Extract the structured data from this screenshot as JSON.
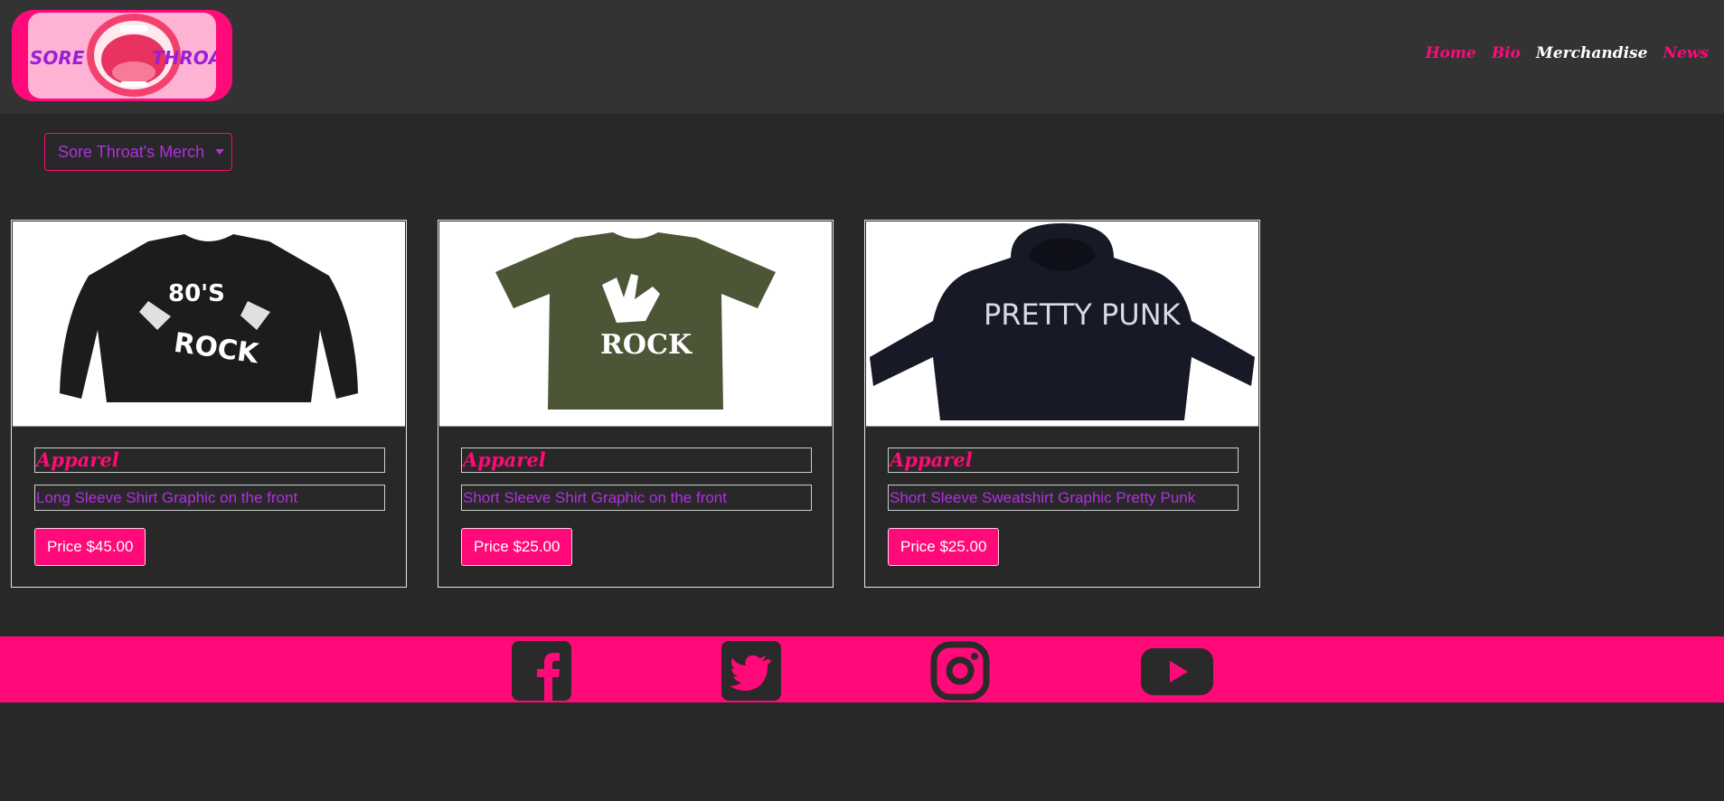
{
  "header": {
    "logo_left_word": "SORE",
    "logo_right_word": "THROAT",
    "nav": [
      {
        "label": "Home",
        "active": false
      },
      {
        "label": "Bio",
        "active": false
      },
      {
        "label": "Merchandise",
        "active": true
      },
      {
        "label": "News",
        "active": false
      }
    ]
  },
  "dropdown": {
    "label": "Sore Throat's Merch",
    "icon": "caret-down-icon"
  },
  "products": [
    {
      "category": "Apparel",
      "description": "Long Sleeve Shirt Graphic on the front",
      "price_label": "Price $45.00",
      "shirt_text_top": "80'S",
      "shirt_text_bottom": "ROCK",
      "shirt_color": "#1c1c1e"
    },
    {
      "category": "Apparel",
      "description": "Short Sleeve Shirt Graphic on the front",
      "price_label": "Price $25.00",
      "shirt_text_bottom": "ROCK",
      "shirt_color": "#4c5636"
    },
    {
      "category": "Apparel",
      "description": "Short Sleeve Sweatshirt Graphic Pretty Punk",
      "price_label": "Price $25.00",
      "shirt_text": "PRETTY PUNK",
      "shirt_color": "#171a26"
    }
  ],
  "footer": {
    "social_icons": [
      "facebook-icon",
      "twitter-icon",
      "instagram-icon",
      "youtube-icon"
    ],
    "icon_color": "#2a2a2a"
  },
  "colors": {
    "accent_pink": "#ff0a78",
    "accent_purple": "#b12fe0",
    "background": "#282828",
    "header_bg": "#333333"
  }
}
